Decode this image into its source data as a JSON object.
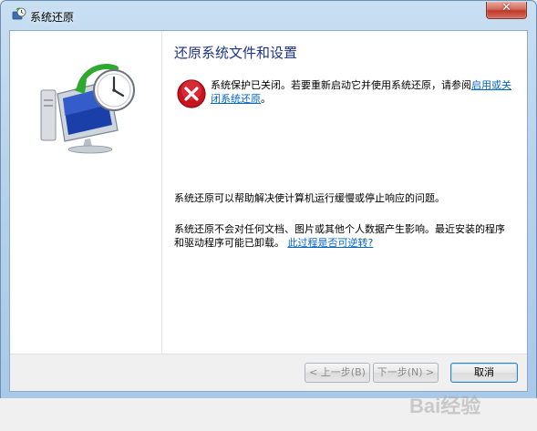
{
  "window": {
    "title": "系统还原",
    "close_label": "✕"
  },
  "page": {
    "heading": "还原系统文件和设置",
    "warning_prefix": "系统保护已关闭。若要重新启动它并使用系统还原，请参阅",
    "warning_link": "启用或关闭系统还原",
    "warning_suffix": "。",
    "desc1": "系统还原可以帮助解决使计算机运行缓慢或停止响应的问题。",
    "desc2_text": "系统还原不会对任何文档、图片或其他个人数据产生影响。最近安装的程序和驱动程序可能已卸载。",
    "desc2_link": "此过程是否可逆转?"
  },
  "buttons": {
    "prev": "< 上一步(B)",
    "next": "下一步(N) >",
    "cancel": "取消"
  },
  "watermark": {
    "text": "Bai经验"
  },
  "icons": {
    "title": "system-restore-icon",
    "hero": "computer-clock-restore-icon",
    "error": "error-icon"
  },
  "colors": {
    "heading": "#1e3287",
    "link": "#0066cc",
    "error": "#c8141e"
  }
}
